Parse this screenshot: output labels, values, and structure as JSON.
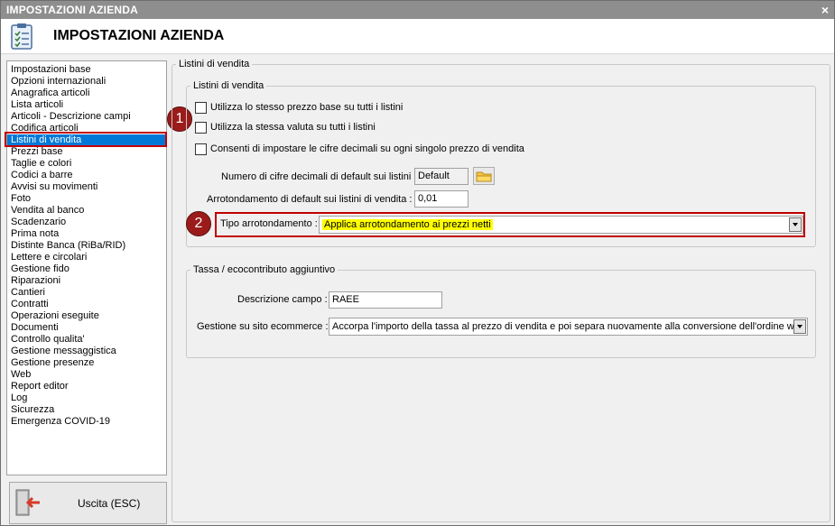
{
  "window": {
    "title": "IMPOSTAZIONI AZIENDA",
    "close_glyph": "×"
  },
  "header": {
    "title": "IMPOSTAZIONI AZIENDA",
    "icon": "clipboard-checklist-icon"
  },
  "sidebar": {
    "items": [
      "Impostazioni base",
      "Opzioni internazionali",
      "Anagrafica articoli",
      "Lista articoli",
      "Articoli - Descrizione campi",
      "Codifica articoli",
      "Listini di vendita",
      "Prezzi base",
      "Taglie e colori",
      "Codici a barre",
      "Avvisi su movimenti",
      "Foto",
      "Vendita al banco",
      "Scadenzario",
      "Prima nota",
      "Distinte Banca (RiBa/RID)",
      "Lettere e circolari",
      "Gestione fido",
      "Riparazioni",
      "Cantieri",
      "Contratti",
      "Operazioni eseguite",
      "Documenti",
      "Controllo qualita'",
      "Gestione messaggistica",
      "Gestione presenze",
      "Web",
      "Report editor",
      "Log",
      "Sicurezza",
      "Emergenza COVID-19"
    ],
    "selected": "Listini di vendita"
  },
  "exit_button": {
    "label": "Uscita (ESC)",
    "icon": "exit-door-icon"
  },
  "panel": {
    "title": "Listini di vendita",
    "group_listini": {
      "title": "Listini di vendita",
      "checkbox1": "Utilizza lo stesso prezzo base su tutti i listini",
      "checkbox2": "Utilizza la stessa valuta su tutti i listini",
      "checkbox3": "Consenti di impostare le cifre decimali su ogni singolo prezzo di vendita",
      "decimals_label": "Numero di cifre decimali di default sui listini :",
      "decimals_value": "Default",
      "rounding_label": "Arrotondamento di default sui listini di vendita :",
      "rounding_value": "0,01",
      "rounding_type_label": "Tipo arrotondamento :",
      "rounding_type_value": "Applica arrotondamento ai prezzi netti"
    },
    "group_tassa": {
      "title": "Tassa / ecocontributo aggiuntivo",
      "field_label": "Descrizione campo :",
      "field_value": "RAEE",
      "ecommerce_label": "Gestione su sito ecommerce :",
      "ecommerce_value": "Accorpa l'importo della tassa al prezzo di vendita e poi separa nuovamente alla conversione dell'ordine web"
    }
  },
  "annotations": {
    "badge1": "1",
    "badge2": "2"
  },
  "colors": {
    "selection": "#0078d7",
    "highlight_border": "#c00000",
    "badge": "#9b1b1b",
    "text_highlight": "#ffff00"
  }
}
